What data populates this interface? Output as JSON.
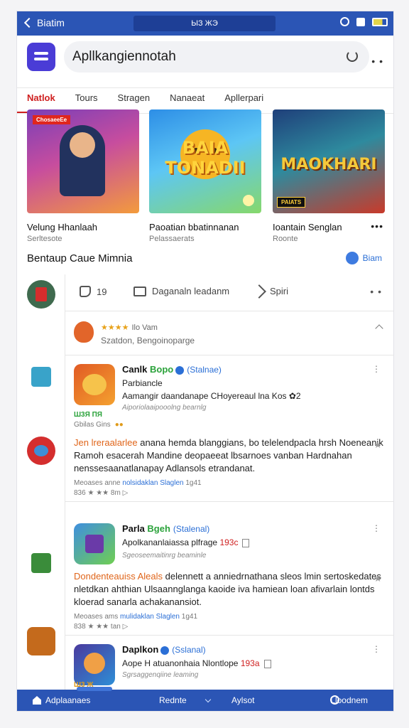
{
  "topbar": {
    "back_label": "Biatim",
    "center_text": "ЫЗ ЖЭ",
    "accent_color": "#2b55b5"
  },
  "header": {
    "search_value": "Apllkangiennotah",
    "icons": [
      "app-logo",
      "refresh-icon",
      "more-icon"
    ]
  },
  "tabs": [
    {
      "label": "Natlok",
      "active": true
    },
    {
      "label": "Tours"
    },
    {
      "label": "Stragen"
    },
    {
      "label": "Nanaeat"
    },
    {
      "label": "Apllerpari"
    }
  ],
  "tiles": [
    {
      "badge": "ChosaeeEe",
      "name": "Velung Hhanlaah",
      "sub": "Serltesote"
    },
    {
      "art_title": "BAIA TONADII",
      "name": "Paoatian bbatinnanan",
      "sub": "Pelassaerats"
    },
    {
      "art_title": "MAOKHARI",
      "tag": "PAIATS",
      "name": "Ioantain Senglan",
      "sub": "Roonte"
    }
  ],
  "section": {
    "title": "Bentaup Caue Mimnia",
    "link": "Biam"
  },
  "actions": {
    "like_count": "19",
    "comment_label": "Daganaln leadanm",
    "share_label": "Spiri"
  },
  "review": {
    "stars": "★★★★",
    "stars_note": "Ilo Vam",
    "subtitle": "Szatdon, Bengoinoparge"
  },
  "cards": [
    {
      "title_a": "Canlk ",
      "title_b": "Bopo",
      "title_c": "(Stalnae)",
      "line1": "Parbiancle",
      "line2": "Aamangir daandanape CHoyereaul lna Kos  ✿2",
      "tiny": "Aiporiolaaipooolng bearnlg",
      "badges": "Ш3Я ПЯ",
      "badges2": "Gbilas Gins",
      "comment_a": "Jen lreraalarlee ",
      "comment_b": "anana hemda blanggians, bo telelendpacla hrsh Noeneanik Ramoh esacerah Mandine deopaeeat lbsarnoes vanban Hardnahan nenssesaanatlanapay Adlansols etrandanat.",
      "meta_a": "Meoases anne ",
      "meta_b": "nolsidaklan  Slaglen",
      "meta_c": "1g41",
      "meta_d": "836   ★   ★★   8m   ▷"
    },
    {
      "title_a": "Parla ",
      "title_b": "Bgeh",
      "title_c": "(Stalenal)",
      "line1": "Apolkananlaiassa plfrage",
      "line1_num": "193c",
      "tiny": "Sgeoseemaitinrg beaminle",
      "comment_a": "Dondenteauiss Aleals ",
      "comment_b": "delennett a anniedrnathana sleos lmin sertoskedates nletdkan ahthian Ulsaannglanga kaoide iva hamiean loan afivarlain lontds kloerad sanarla achakanansiot.",
      "meta_a": "Meoases ams ",
      "meta_b": "mulidaklan  Slaglen",
      "meta_c": "1g41",
      "meta_d": "838   ★   ★★   tan   ▷"
    },
    {
      "title_a": "Daplkon",
      "title_b": "",
      "title_c": "(Sslanal)",
      "line1": "Aope H atuanonhaia Nlontlope",
      "line1_num": "193a",
      "tiny": "Sgrsaggenqiine leaming",
      "badges": "Ш3  Ж"
    }
  ],
  "bottomnav": {
    "item1": "Adplaanaes",
    "item2": "Rednte",
    "item3": "Aylsot",
    "item4": "Lloodnem"
  }
}
